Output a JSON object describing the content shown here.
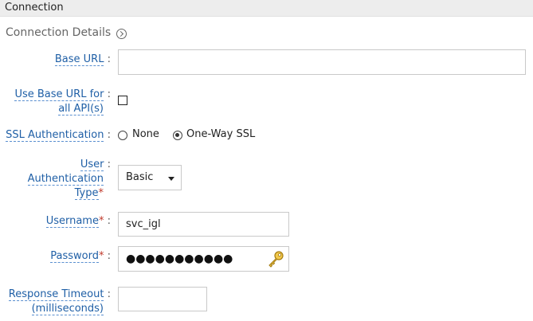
{
  "header": {
    "title": "Connection"
  },
  "section": {
    "title": "Connection Details"
  },
  "fields": {
    "base_url": {
      "label": "Base URL",
      "colon": ":",
      "value": ""
    },
    "use_base_url": {
      "label_line1": "Use Base URL for",
      "label_line2": "all API(s)",
      "colon": ":",
      "checked": false
    },
    "ssl": {
      "label": "SSL Authentication",
      "colon": ":",
      "options": [
        "None",
        "One-Way SSL"
      ],
      "selected": "One-Way SSL"
    },
    "auth_type": {
      "label_line1": "User",
      "label_line2": "Authentication",
      "label_line3": "Type",
      "required": "*",
      "colon": ":",
      "value": "Basic"
    },
    "username": {
      "label": "Username",
      "required": "*",
      "colon": ":",
      "value": "svc_igl"
    },
    "password": {
      "label": "Password",
      "required": "*",
      "colon": ":",
      "masked_value": "●●●●●●●●●●●"
    },
    "timeout": {
      "label_line1": "Response Timeout",
      "label_line2": "(milliseconds)",
      "colon": ":",
      "value": ""
    }
  },
  "icons": {
    "section_toggle": "chevron-right-circle-icon",
    "password_key": "key-icon"
  }
}
